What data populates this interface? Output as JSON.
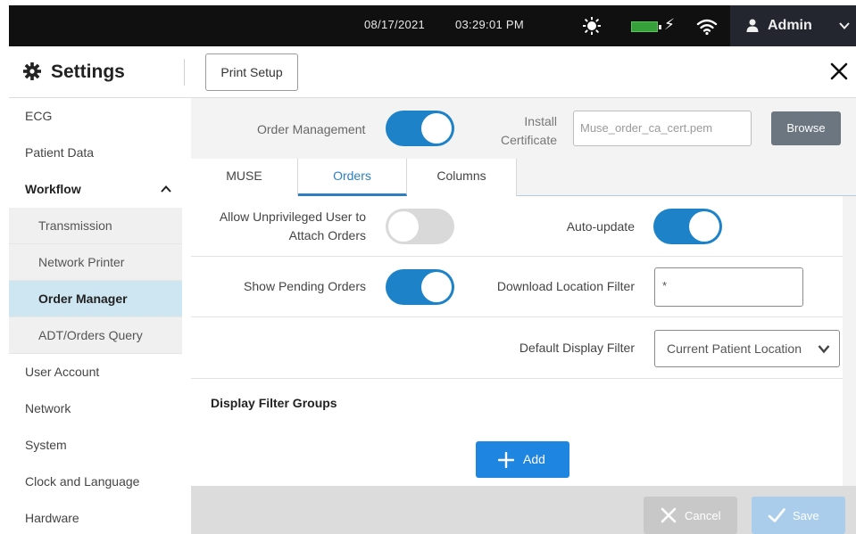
{
  "status_bar": {
    "date": "08/17/2021",
    "time": "03:29:01 PM",
    "icons": [
      "brightness-icon",
      "battery-icon",
      "charging-bolt-icon",
      "wifi-icon"
    ],
    "battery_color": "#36a03a",
    "user": "Admin"
  },
  "header": {
    "title": "Settings",
    "print_setup": "Print Setup"
  },
  "sidebar": {
    "items": [
      {
        "label": "ECG"
      },
      {
        "label": "Patient Data"
      },
      {
        "label": "Workflow",
        "expanded": true
      },
      {
        "label": "User Account"
      },
      {
        "label": "Network"
      },
      {
        "label": "System"
      },
      {
        "label": "Clock and Language"
      },
      {
        "label": "Hardware"
      }
    ],
    "workflow_sub": [
      {
        "label": "Transmission"
      },
      {
        "label": "Network Printer"
      },
      {
        "label": "Order Manager",
        "active": true
      },
      {
        "label": "ADT/Orders Query"
      }
    ]
  },
  "order_bar": {
    "order_management_label": "Order Management",
    "order_management_on": true,
    "install_label": "Install Certificate",
    "install_line1": "Install",
    "install_line2": "Certificate",
    "cert_placeholder": "Muse_order_ca_cert.pem",
    "browse": "Browse"
  },
  "tabs": [
    {
      "label": "MUSE"
    },
    {
      "label": "Orders",
      "active": true
    },
    {
      "label": "Columns"
    }
  ],
  "orders": {
    "allow_unprivileged_line1": "Allow Unprivileged User to",
    "allow_unprivileged_line2": "Attach Orders",
    "allow_unprivileged_on": false,
    "auto_update_label": "Auto-update",
    "auto_update_on": true,
    "show_pending_label": "Show Pending Orders",
    "show_pending_on": true,
    "download_location_label": "Download Location Filter",
    "download_location_value": "*",
    "default_display_label": "Default Display Filter",
    "default_display_value": "Current Patient Location",
    "display_filter_groups_label": "Display Filter Groups",
    "add_label": "Add"
  },
  "footer": {
    "cancel": "Cancel",
    "save": "Save"
  },
  "colors": {
    "accent": "#1d82c8",
    "active_nav": "#cde6f2",
    "add_button": "#1e86e0",
    "browse_button": "#6b7680"
  }
}
